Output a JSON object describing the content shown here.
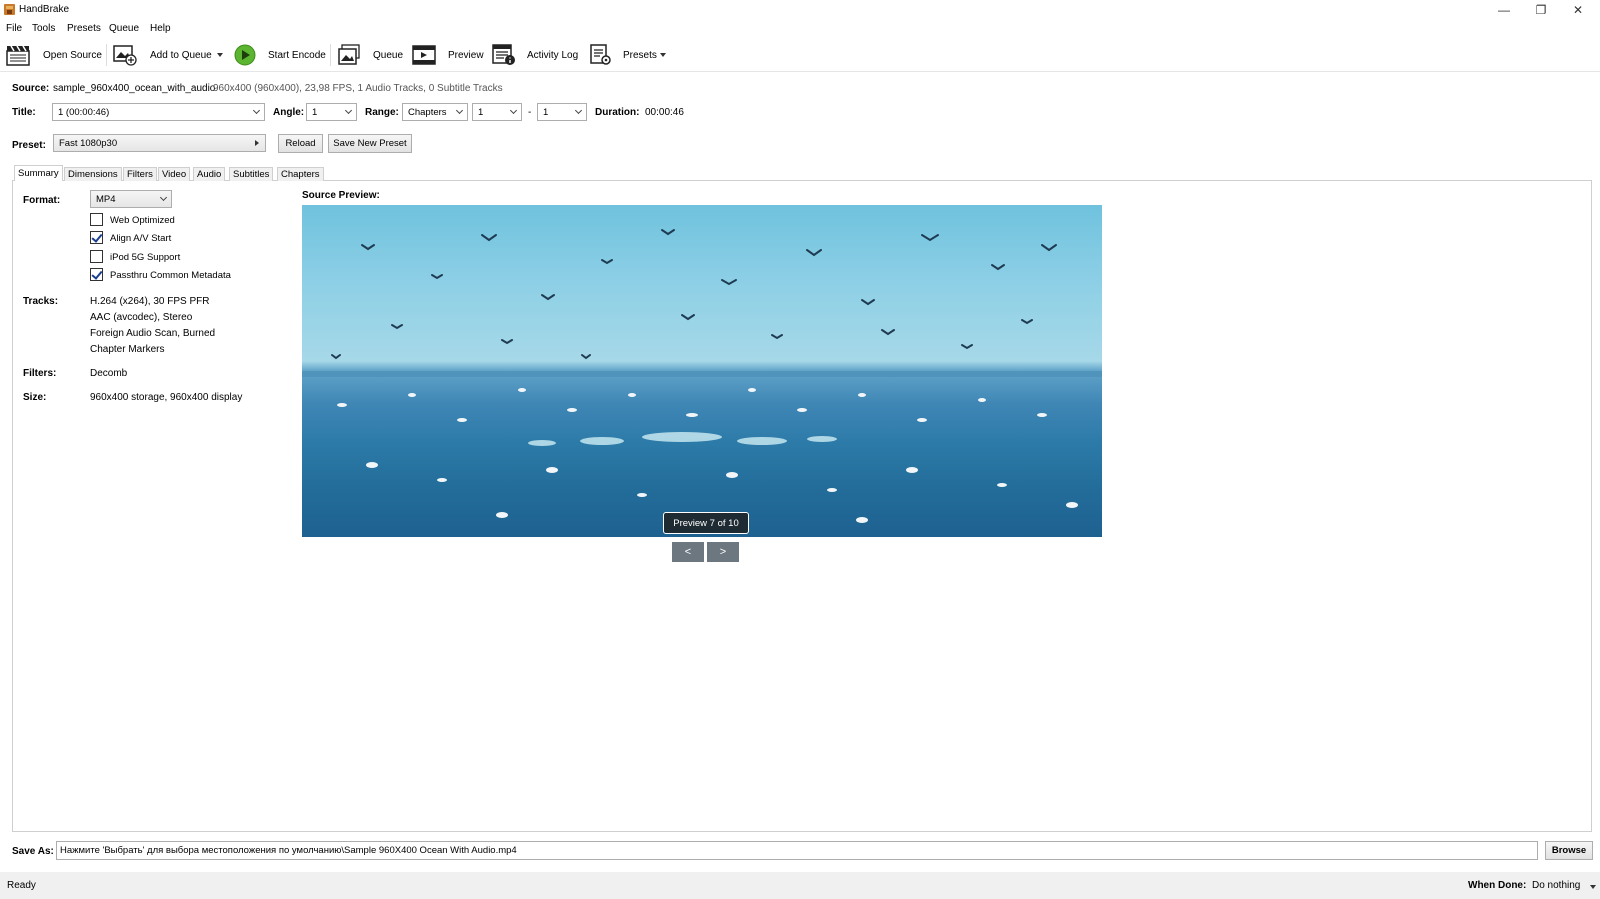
{
  "window": {
    "title": "HandBrake",
    "minimize": "—",
    "restore": "❐",
    "close": "✕"
  },
  "menu": [
    "File",
    "Tools",
    "Presets",
    "Queue",
    "Help"
  ],
  "toolbar": {
    "open_source": "Open Source",
    "add_to_queue": "Add to Queue",
    "start_encode": "Start Encode",
    "queue": "Queue",
    "preview": "Preview",
    "activity_log": "Activity Log",
    "presets": "Presets"
  },
  "source": {
    "label": "Source:",
    "name": "sample_960x400_ocean_with_audio",
    "info": "960x400 (960x400), 23,98 FPS, 1 Audio Tracks, 0 Subtitle Tracks"
  },
  "title_row": {
    "title_label": "Title:",
    "title_value": "1 (00:00:46)",
    "angle_label": "Angle:",
    "angle_value": "1",
    "range_label": "Range:",
    "range_value": "Chapters",
    "range_start": "1",
    "range_sep": "-",
    "range_end": "1",
    "duration_label": "Duration:",
    "duration_value": "00:00:46"
  },
  "preset": {
    "label": "Preset:",
    "value": "Fast 1080p30",
    "reload": "Reload",
    "save_new": "Save New Preset"
  },
  "tabs": [
    "Summary",
    "Dimensions",
    "Filters",
    "Video",
    "Audio",
    "Subtitles",
    "Chapters"
  ],
  "summary": {
    "format_label": "Format:",
    "format_value": "MP4",
    "options": [
      {
        "label": "Web Optimized",
        "checked": false
      },
      {
        "label": "Align A/V Start",
        "checked": true
      },
      {
        "label": "iPod 5G Support",
        "checked": false
      },
      {
        "label": "Passthru Common Metadata",
        "checked": true
      }
    ],
    "tracks_label": "Tracks:",
    "tracks": [
      "H.264 (x264), 30 FPS PFR",
      "AAC (avcodec), Stereo",
      "Foreign Audio Scan, Burned",
      "Chapter Markers"
    ],
    "filters_label": "Filters:",
    "filters_value": "Decomb",
    "size_label": "Size:",
    "size_value": "960x400 storage, 960x400 display"
  },
  "preview_panel": {
    "label": "Source Preview:",
    "badge": "Preview 7 of 10",
    "prev": "<",
    "next": ">"
  },
  "save_as": {
    "label": "Save As:",
    "value": "Нажмите 'Выбрать' для выбора местоположения по умолчанию\\Sample 960X400 Ocean With Audio.mp4",
    "browse": "Browse"
  },
  "status": {
    "text": "Ready",
    "when_done_label": "When Done:",
    "when_done_value": "Do nothing"
  },
  "colors": {
    "accent_green": "#5cb531",
    "sea": "#2c7aa8",
    "sky": "#8fd0e6"
  }
}
